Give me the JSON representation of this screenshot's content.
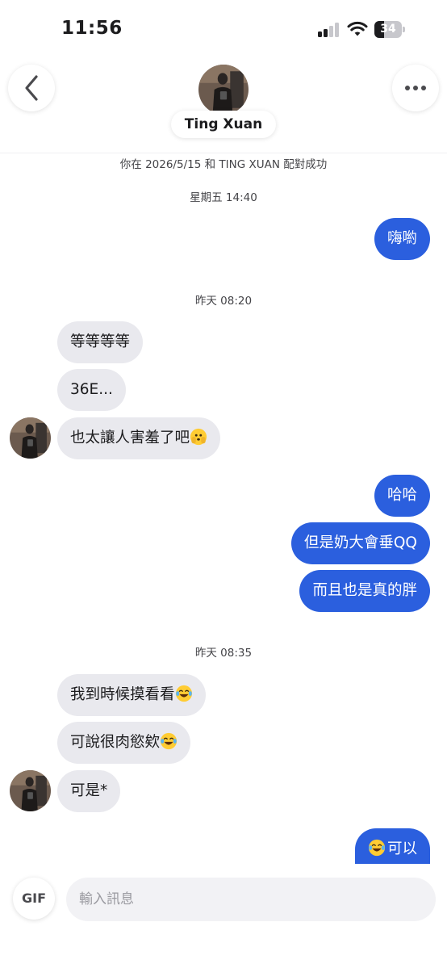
{
  "status_bar": {
    "time": "11:56",
    "battery": "34",
    "battery_level": 0.34
  },
  "header": {
    "name": "Ting Xuan"
  },
  "chat": {
    "match_notice": "你在 2026/5/15 和 TING XUAN 配對成功",
    "groups": [
      {
        "timestamp": "星期五 14:40",
        "messages": [
          {
            "from": "me",
            "text": "嗨喲"
          }
        ]
      },
      {
        "timestamp": "昨天 08:20",
        "messages": [
          {
            "from": "them",
            "text": "等等等等"
          },
          {
            "from": "them",
            "text": "36E..."
          },
          {
            "from": "them",
            "text": "也太讓人害羞了吧",
            "emoji": "face-peeking-icon"
          },
          {
            "from": "me",
            "text": "哈哈"
          },
          {
            "from": "me",
            "text": "但是奶大會垂QQ"
          },
          {
            "from": "me",
            "text": "而且也是真的胖"
          }
        ]
      },
      {
        "timestamp": "昨天 08:35",
        "messages": [
          {
            "from": "them",
            "text": "我到時候摸看看",
            "emoji": "tears-of-joy-icon"
          },
          {
            "from": "them",
            "text": "可說很肉慾欸",
            "emoji": "tears-of-joy-icon"
          },
          {
            "from": "them",
            "text": "可是*"
          },
          {
            "from": "me",
            "text": "可以",
            "emoji": "tears-of-joy-icon"
          }
        ]
      }
    ]
  },
  "composer": {
    "gif_label": "GIF",
    "placeholder": "輸入訊息"
  },
  "colors": {
    "outgoing_bubble": "#2b5fde",
    "incoming_bubble": "#e9e9ee",
    "timestamp_text": "#444448"
  }
}
